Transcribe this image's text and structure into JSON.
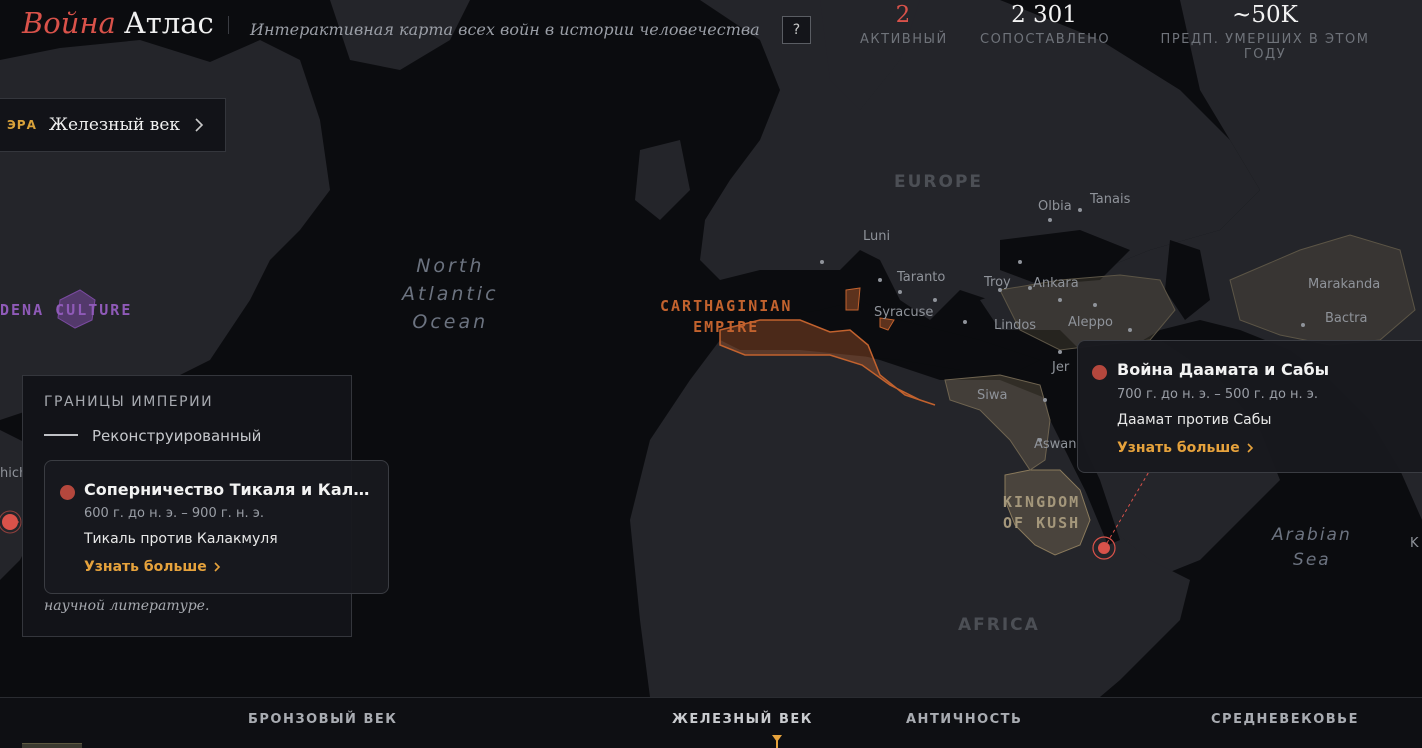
{
  "header": {
    "brand_a": "Война",
    "brand_b": "Атлас",
    "tagline": "Интерактивная карта всех войн в истории человечества",
    "help_label": "?",
    "stats": [
      {
        "value": "2",
        "label": "АКТИВНЫЙ"
      },
      {
        "value": "2 301",
        "label": "СОПОСТАВЛЕНО"
      },
      {
        "value": "~50K",
        "label": "ПРЕДП. УМЕРШИХ В ЭТОМ ГОДУ"
      }
    ]
  },
  "era": {
    "key": "ЭРА",
    "name": "Железный век"
  },
  "legend": {
    "title": "ГРАНИЦЫ ИМПЕРИИ",
    "line_label": "Реконструированный",
    "note": "научной литературе."
  },
  "map": {
    "oceans": {
      "atlantic": "North\nAtlantic\nOcean",
      "arabian": "Arabian\nSea"
    },
    "regions": {
      "europe": "EUROPE",
      "africa": "AFRICA"
    },
    "empires": {
      "carthage": "CARTHAGINIAN\nEMPIRE",
      "kush": "KINGDOM\nOF KUSH",
      "adena": "DENA CULTURE"
    },
    "cities": {
      "olbia": "Olbia",
      "tanais": "Tanais",
      "luni": "Luni",
      "taranto": "Taranto",
      "troy": "Troy",
      "ankara": "Ankara",
      "marakanda": "Marakanda",
      "syracuse": "Syracuse",
      "lindos": "Lindos",
      "aleppo": "Aleppo",
      "bactra": "Bactra",
      "jer": "Jer",
      "siwa": "Siwa",
      "aswan": "Aswan",
      "chi": "hich",
      "k": "K"
    },
    "colors": {
      "carthage": "#c2622e",
      "kush": "#8a7a5c",
      "adena": "#7a4aa0",
      "war": "#d9524a"
    }
  },
  "cards": [
    {
      "title": "Соперничество Тикаля и Калак...",
      "dates": "600 г. до н. э. – 900 г. н. э.",
      "parties": "Тикаль против Калакмуля",
      "more": "Узнать больше"
    },
    {
      "title": "Война Даамата и Сабы",
      "dates": "700 г. до н. э. – 500 г. до н. э.",
      "parties": "Даамат против Сабы",
      "more": "Узнать больше"
    }
  ],
  "timeline": {
    "eras": [
      {
        "label": "БРОНЗОВЫЙ ВЕК"
      },
      {
        "label": "ЖЕЛЕЗНЫЙ ВЕК"
      },
      {
        "label": "АНТИЧНОСТЬ"
      },
      {
        "label": "СРЕДНЕВЕКОВЬЕ"
      }
    ],
    "current": "ЖЕЛЕЗНЫЙ ВЕК"
  }
}
